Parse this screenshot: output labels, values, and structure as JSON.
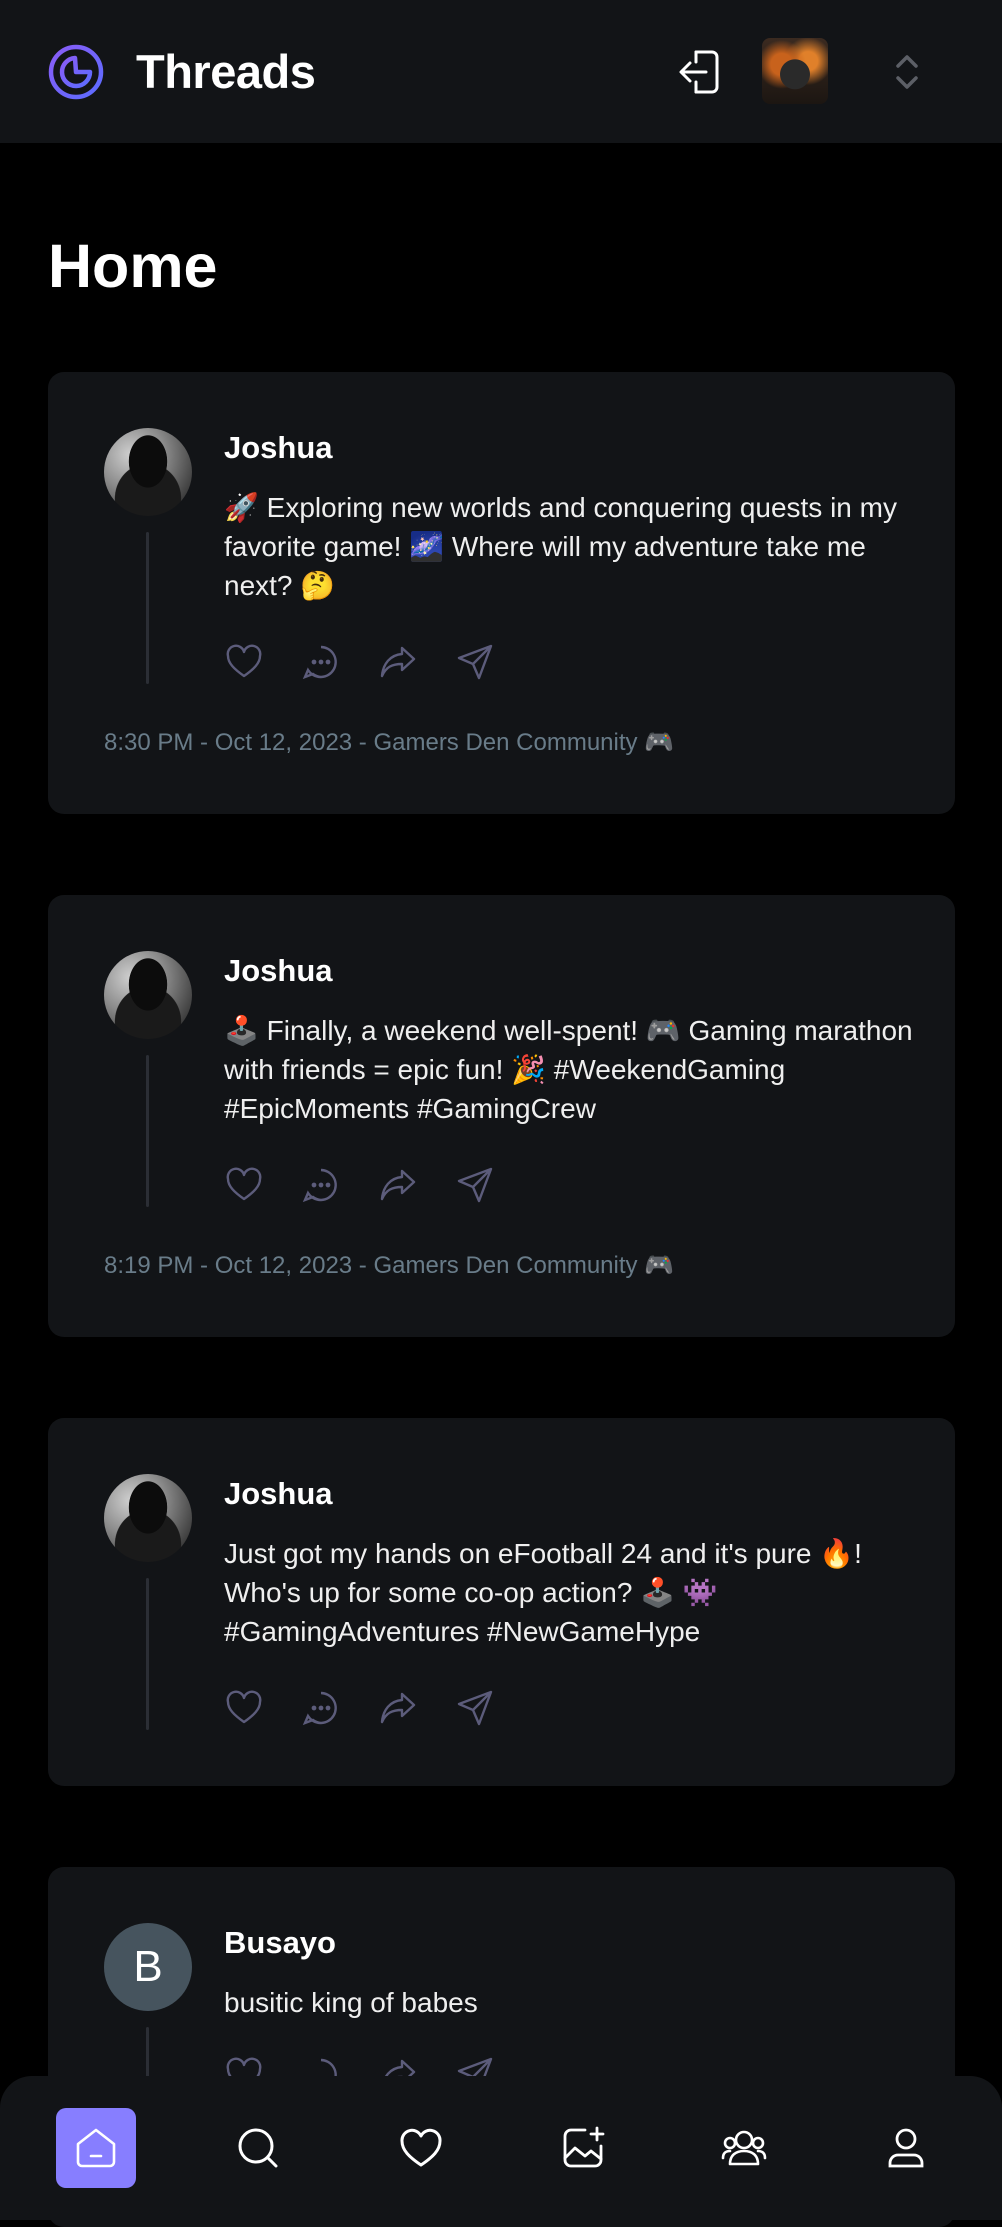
{
  "topbar": {
    "app_title": "Threads",
    "logo_icon": "threads-logo-icon",
    "logout_icon": "logout-icon",
    "switcher_icon": "chevron-up-down-icon",
    "accent": "#877eff"
  },
  "page": {
    "title": "Home"
  },
  "threads": [
    {
      "author": "Joshua",
      "content": "🚀 Exploring new worlds and conquering quests in my favorite game! 🌌 Where will my adventure take me next? 🤔",
      "meta": "8:30 PM - Oct 12, 2023 - Gamers Den Community 🎮"
    },
    {
      "author": "Joshua",
      "content": "🕹️ Finally, a weekend well-spent! 🎮 Gaming marathon with friends = epic fun! 🎉 #WeekendGaming #EpicMoments #GamingCrew",
      "meta": "8:19 PM - Oct 12, 2023 - Gamers Den Community 🎮"
    },
    {
      "author": "Joshua",
      "content": "Just got my hands on eFootball 24 and it's pure 🔥! Who's up for some co-op action? 🕹️ 👾 #GamingAdventures #NewGameHype",
      "meta": ""
    },
    {
      "author": "Busayo",
      "avatar_letter": "B",
      "content": "busitic king of babes",
      "meta": ""
    }
  ],
  "action_icons": [
    "heart-icon",
    "reply-icon",
    "repost-icon",
    "share-icon"
  ],
  "bottom_nav": [
    {
      "name": "home",
      "icon": "home-icon",
      "active": true
    },
    {
      "name": "search",
      "icon": "search-icon",
      "active": false
    },
    {
      "name": "activity",
      "icon": "heart-icon",
      "active": false
    },
    {
      "name": "create-thread",
      "icon": "create-thread-icon",
      "active": false
    },
    {
      "name": "communities",
      "icon": "communities-icon",
      "active": false
    },
    {
      "name": "profile",
      "icon": "profile-icon",
      "active": false
    }
  ],
  "colors": {
    "background": "#000000",
    "surface": "#121417",
    "muted": "#697c89",
    "active_nav": "#877eff"
  }
}
